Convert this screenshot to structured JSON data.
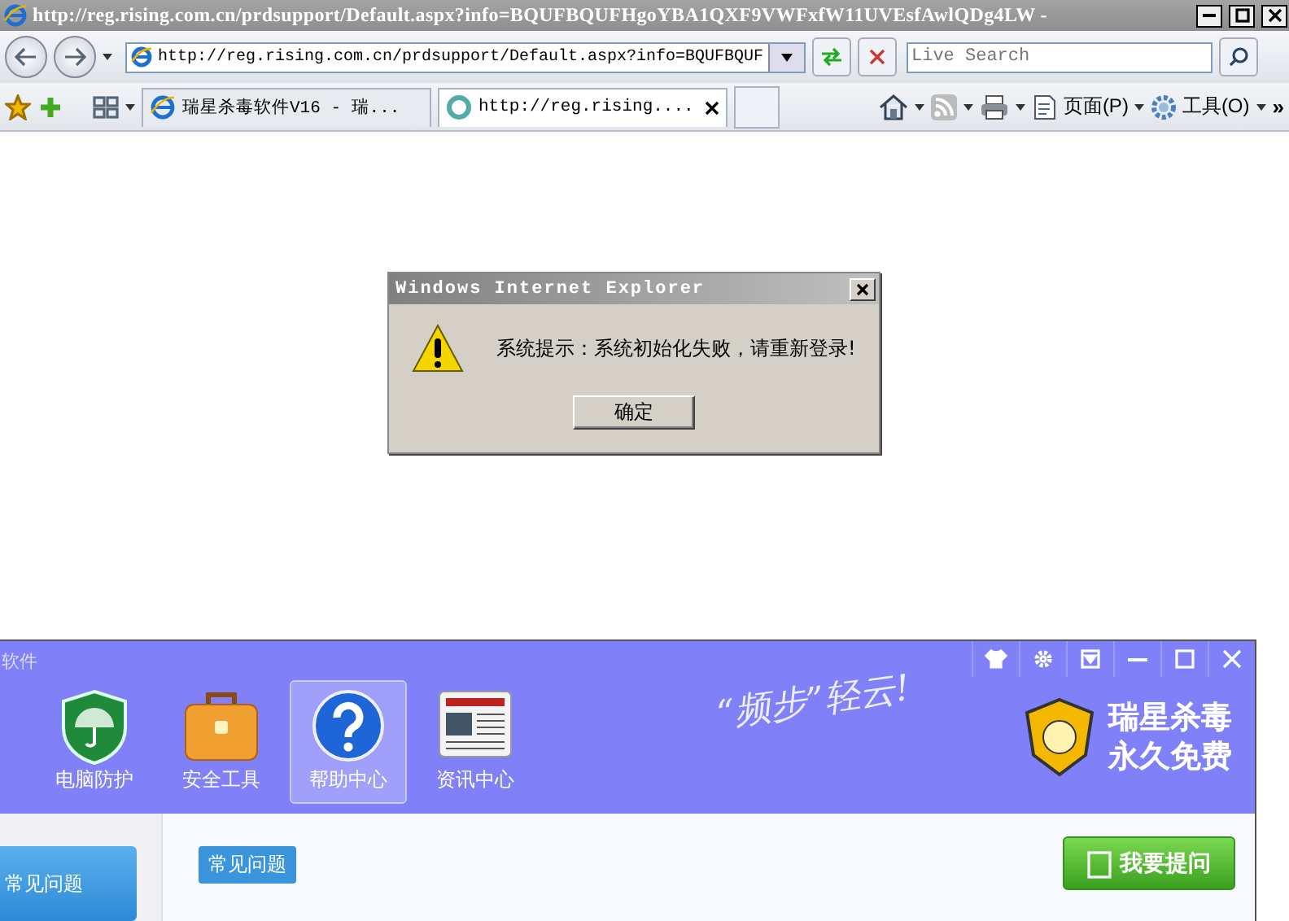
{
  "browser": {
    "title": "http://reg.rising.com.cn/prdsupport/Default.aspx?info=BQUFBQUFHgoYBA1QXF9VWFxfW11UVEsfAwlQDg4LW -",
    "address": "http://reg.rising.com.cn/prdsupport/Default.aspx?info=BQUFBQUF",
    "search": {
      "placeholder": "Live Search"
    },
    "tabs": [
      {
        "label": "瑞星杀毒软件V16 - 瑞...",
        "selected": false
      },
      {
        "label": "http://reg.rising....",
        "selected": true
      }
    ],
    "toolbar": [
      {
        "kind": "home"
      },
      {
        "kind": "feeds"
      },
      {
        "kind": "print"
      },
      {
        "kind": "page",
        "label": "页面(P)"
      },
      {
        "kind": "tools",
        "label": "工具(O)"
      }
    ],
    "overflow": "»"
  },
  "dialog": {
    "title": "Windows Internet Explorer",
    "message": "系统提示：系统初始化失败，请重新登录!",
    "button": "确定"
  },
  "app": {
    "title": "软件",
    "nav": [
      {
        "kind": "shield",
        "label": "电脑防护",
        "selected": false
      },
      {
        "kind": "toolbox",
        "label": "安全工具",
        "selected": false
      },
      {
        "kind": "help",
        "label": "帮助中心",
        "selected": true
      },
      {
        "kind": "news",
        "label": "资讯中心",
        "selected": false
      }
    ],
    "slogan": "“频步”轻云!",
    "brand": [
      "瑞星杀毒",
      "永久免费"
    ],
    "side_items": [
      {
        "label": "常见问题",
        "selected": true
      }
    ],
    "section_tag": "常见问题",
    "ask_button": "我要提问"
  }
}
